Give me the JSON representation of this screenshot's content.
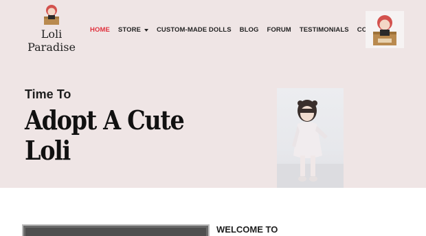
{
  "brand": {
    "name_line1": "Loli",
    "name_line2": "Paradise"
  },
  "nav": {
    "items": [
      {
        "label": "HOME",
        "active": true
      },
      {
        "label": "STORE",
        "dropdown": true
      },
      {
        "label": "CUSTOM-MADE DOLLS"
      },
      {
        "label": "BLOG"
      },
      {
        "label": "FORUM"
      },
      {
        "label": "TESTIMONIALS"
      },
      {
        "label": "CONTACT"
      }
    ]
  },
  "hero": {
    "eyebrow": "Time To",
    "headline": "Adopt A Cute Loli"
  },
  "section": {
    "heading": "WELCOME TO"
  },
  "colors": {
    "hero_bg": "#efe5e5",
    "nav_active": "#e0303c",
    "text": "#222222"
  }
}
